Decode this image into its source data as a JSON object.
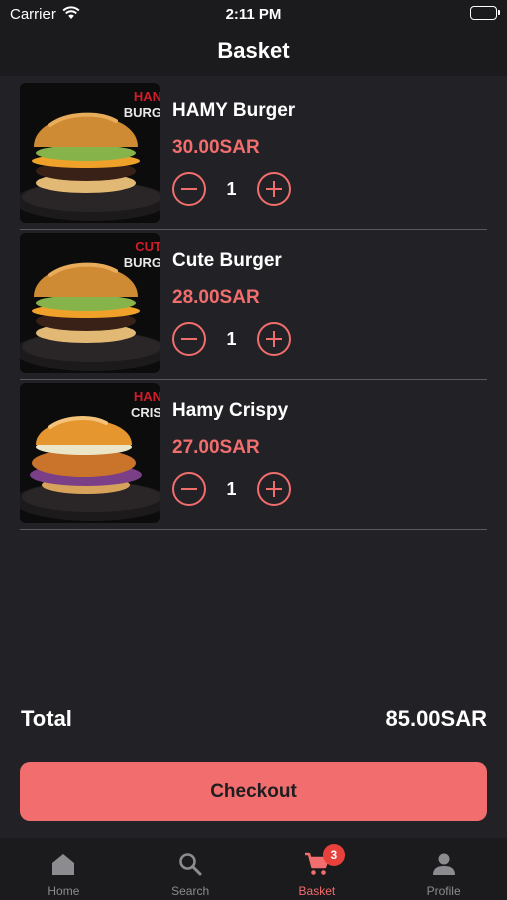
{
  "status_bar": {
    "carrier": "Carrier",
    "time": "2:11 PM"
  },
  "header": {
    "title": "Basket"
  },
  "items": [
    {
      "name": "HAMY Burger",
      "price": "30.00SAR",
      "quantity": "1",
      "image_text": [
        "HAN",
        "BURG"
      ],
      "image_style": "classic"
    },
    {
      "name": "Cute Burger",
      "price": "28.00SAR",
      "quantity": "1",
      "image_text": [
        "CUT",
        "BURG"
      ],
      "image_style": "classic"
    },
    {
      "name": "Hamy Crispy",
      "price": "27.00SAR",
      "quantity": "1",
      "image_text": [
        "HAN",
        "CRIS"
      ],
      "image_style": "crispy"
    }
  ],
  "total": {
    "label": "Total",
    "value": "85.00SAR"
  },
  "checkout": {
    "label": "Checkout"
  },
  "tabbar": {
    "tabs": [
      {
        "label": "Home",
        "icon": "home-icon"
      },
      {
        "label": "Search",
        "icon": "search-icon"
      },
      {
        "label": "Basket",
        "icon": "cart-icon",
        "badge": "3",
        "active": true
      },
      {
        "label": "Profile",
        "icon": "person-icon"
      }
    ]
  },
  "colors": {
    "accent": "#f26d6d",
    "background": "#222226",
    "bar": "#1b1b1d",
    "badge": "#e8413c"
  }
}
